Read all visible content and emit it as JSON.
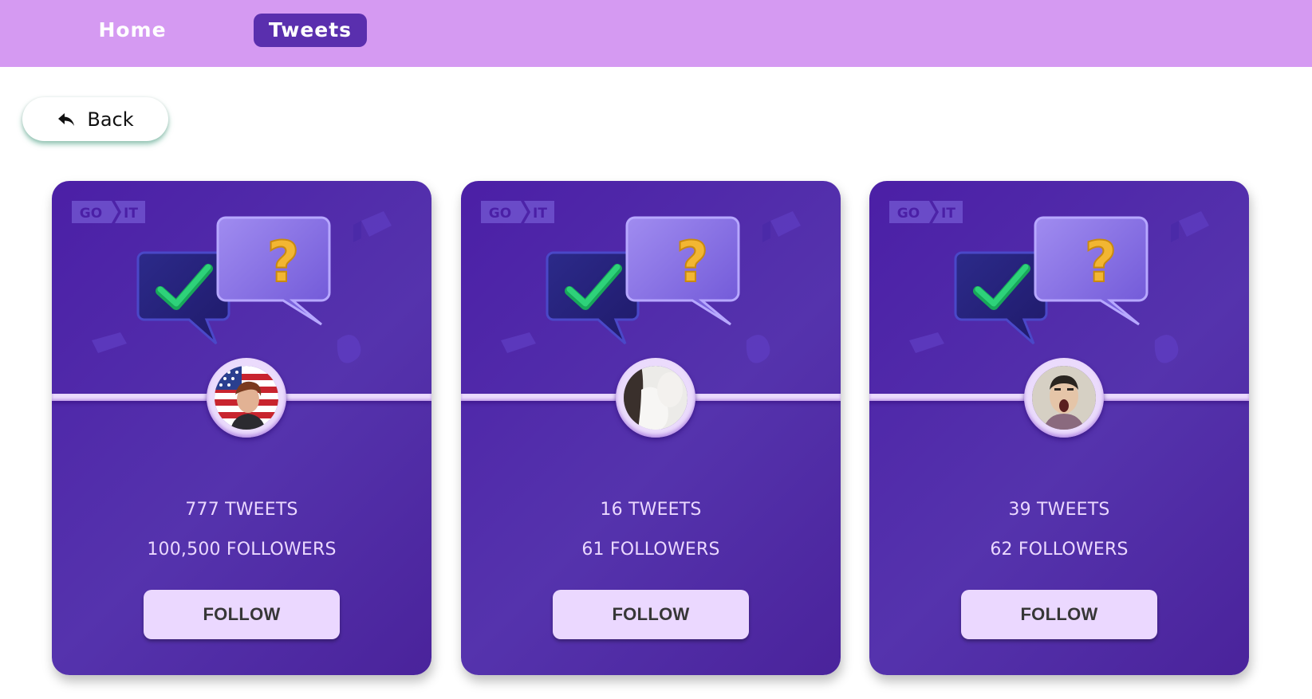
{
  "nav": {
    "home_label": "Home",
    "tweets_label": "Tweets",
    "active": "Tweets"
  },
  "back_button": {
    "label": "Back",
    "icon": "reply-arrow-icon"
  },
  "logo": {
    "left": "GO",
    "right": "IT"
  },
  "colors": {
    "nav_bg": "#d59af2",
    "nav_active": "#5a2fae",
    "card_bg": "#4b1fa6",
    "accent_light": "#ebd8ff",
    "follow_text": "#373737"
  },
  "cards": [
    {
      "tweets": "777 TWEETS",
      "followers": "100,500 FOLLOWERS",
      "button": "FOLLOW",
      "avatar": "flag-portrait"
    },
    {
      "tweets": "16 TWEETS",
      "followers": "61 FOLLOWERS",
      "button": "FOLLOW",
      "avatar": "light-portrait"
    },
    {
      "tweets": "39 TWEETS",
      "followers": "62 FOLLOWERS",
      "button": "FOLLOW",
      "avatar": "screaming-man"
    }
  ]
}
